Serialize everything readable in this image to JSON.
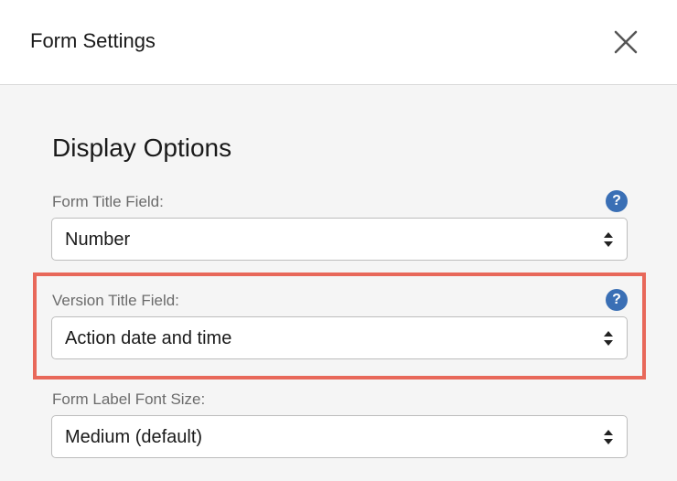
{
  "header": {
    "title": "Form Settings"
  },
  "section": {
    "title": "Display Options"
  },
  "fields": [
    {
      "label": "Form Title Field:",
      "value": "Number"
    },
    {
      "label": "Version Title Field:",
      "value": "Action date and time"
    },
    {
      "label": "Form Label Font Size:",
      "value": "Medium (default)"
    }
  ],
  "help_icon_glyph": "?",
  "colors": {
    "highlight": "#e8685a",
    "help_icon": "#3a6fb5"
  }
}
